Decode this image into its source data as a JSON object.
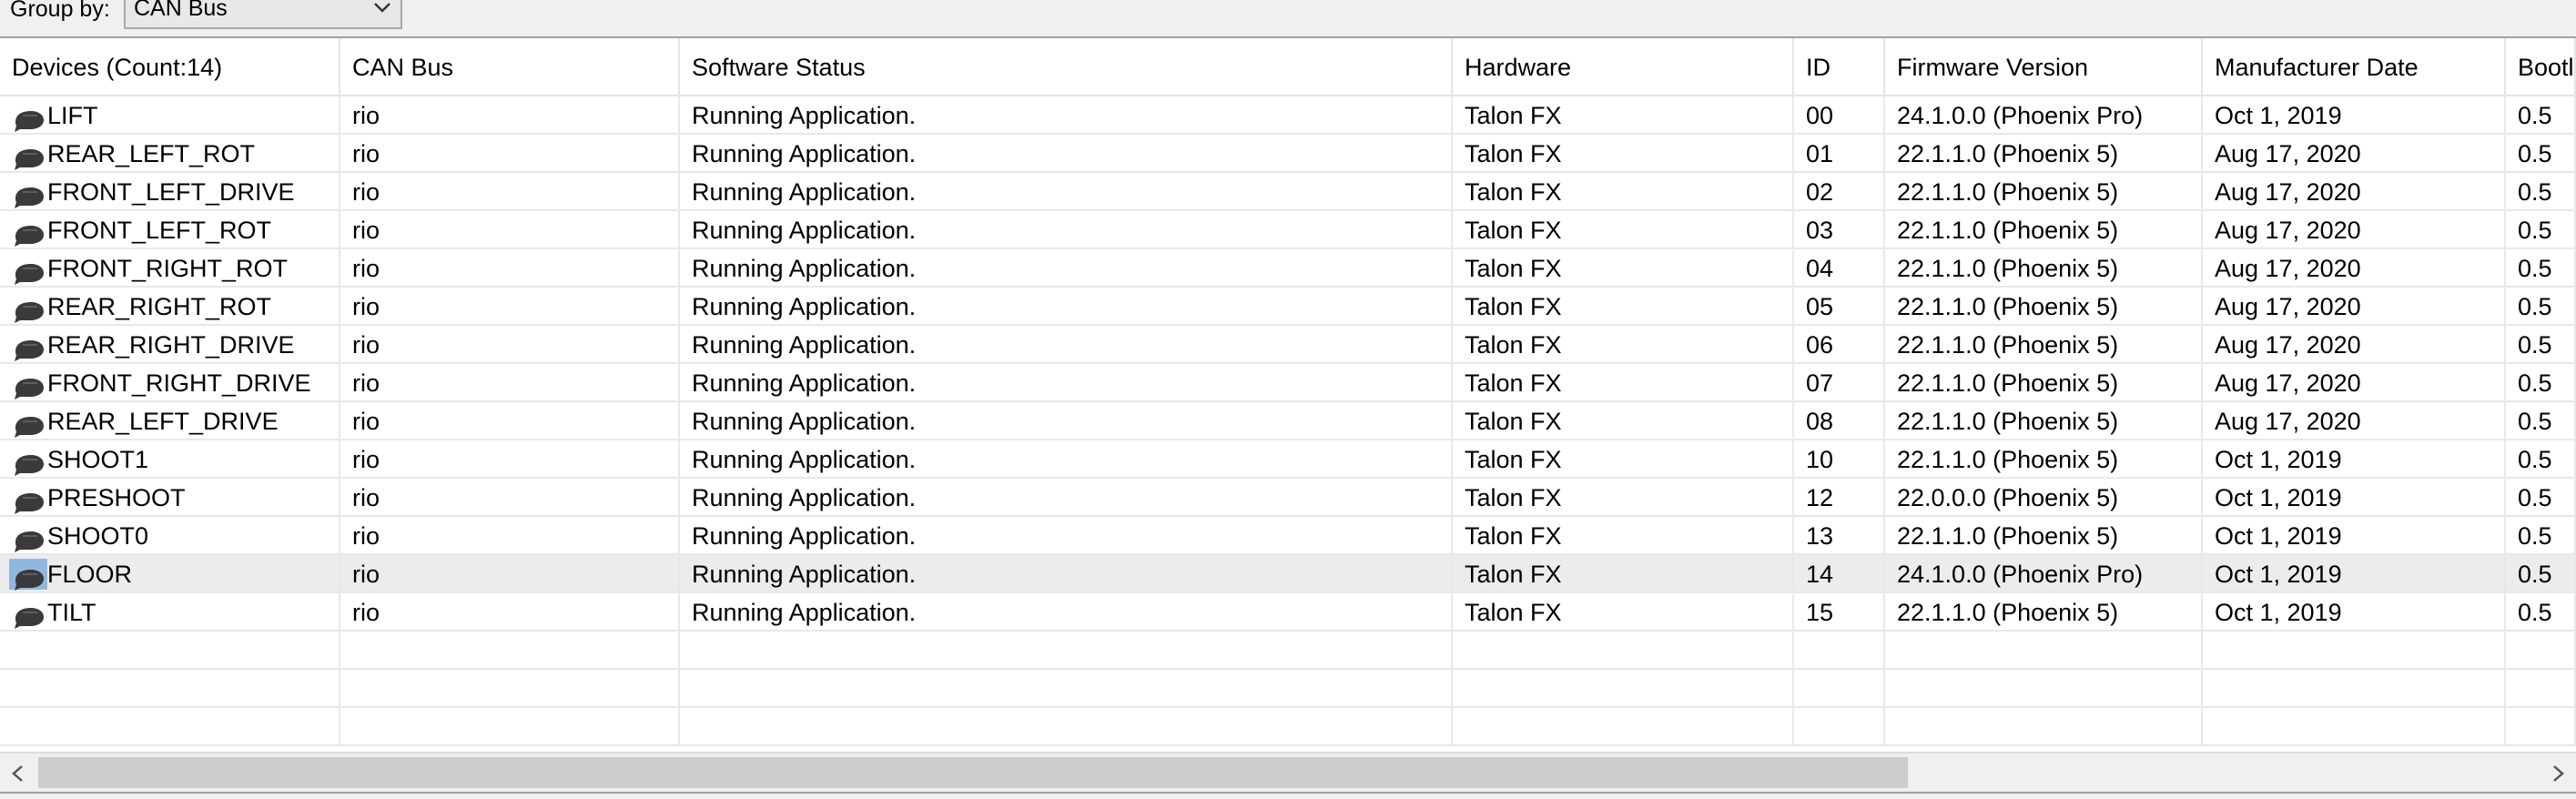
{
  "toolbar": {
    "group_by_label": "Group by:",
    "group_by_value": "CAN Bus"
  },
  "table": {
    "headers": [
      "Devices (Count:14)",
      "CAN Bus",
      "Software Status",
      "Hardware",
      "ID",
      "Firmware Version",
      "Manufacturer Date",
      "Bootl"
    ],
    "rows": [
      [
        "LIFT",
        "rio",
        "Running Application.",
        "Talon FX",
        "00",
        "24.1.0.0 (Phoenix Pro)",
        "Oct 1, 2019",
        "0.5"
      ],
      [
        "REAR_LEFT_ROT",
        "rio",
        "Running Application.",
        "Talon FX",
        "01",
        "22.1.1.0 (Phoenix 5)",
        "Aug 17, 2020",
        "0.5"
      ],
      [
        "FRONT_LEFT_DRIVE",
        "rio",
        "Running Application.",
        "Talon FX",
        "02",
        "22.1.1.0 (Phoenix 5)",
        "Aug 17, 2020",
        "0.5"
      ],
      [
        "FRONT_LEFT_ROT",
        "rio",
        "Running Application.",
        "Talon FX",
        "03",
        "22.1.1.0 (Phoenix 5)",
        "Aug 17, 2020",
        "0.5"
      ],
      [
        "FRONT_RIGHT_ROT",
        "rio",
        "Running Application.",
        "Talon FX",
        "04",
        "22.1.1.0 (Phoenix 5)",
        "Aug 17, 2020",
        "0.5"
      ],
      [
        "REAR_RIGHT_ROT",
        "rio",
        "Running Application.",
        "Talon FX",
        "05",
        "22.1.1.0 (Phoenix 5)",
        "Aug 17, 2020",
        "0.5"
      ],
      [
        "REAR_RIGHT_DRIVE",
        "rio",
        "Running Application.",
        "Talon FX",
        "06",
        "22.1.1.0 (Phoenix 5)",
        "Aug 17, 2020",
        "0.5"
      ],
      [
        "FRONT_RIGHT_DRIVE",
        "rio",
        "Running Application.",
        "Talon FX",
        "07",
        "22.1.1.0 (Phoenix 5)",
        "Aug 17, 2020",
        "0.5"
      ],
      [
        "REAR_LEFT_DRIVE",
        "rio",
        "Running Application.",
        "Talon FX",
        "08",
        "22.1.1.0 (Phoenix 5)",
        "Aug 17, 2020",
        "0.5"
      ],
      [
        "SHOOT1",
        "rio",
        "Running Application.",
        "Talon FX",
        "10",
        "22.1.1.0 (Phoenix 5)",
        "Oct 1, 2019",
        "0.5"
      ],
      [
        "PRESHOOT",
        "rio",
        "Running Application.",
        "Talon FX",
        "12",
        "22.0.0.0 (Phoenix 5)",
        "Oct 1, 2019",
        "0.5"
      ],
      [
        "SHOOT0",
        "rio",
        "Running Application.",
        "Talon FX",
        "13",
        "22.1.1.0 (Phoenix 5)",
        "Oct 1, 2019",
        "0.5"
      ],
      [
        "FLOOR",
        "rio",
        "Running Application.",
        "Talon FX",
        "14",
        "24.1.0.0 (Phoenix Pro)",
        "Oct 1, 2019",
        "0.5"
      ],
      [
        "TILT",
        "rio",
        "Running Application.",
        "Talon FX",
        "15",
        "22.1.1.0 (Phoenix 5)",
        "Oct 1, 2019",
        "0.5"
      ]
    ],
    "selected_row": 12,
    "device_icon": "talon-fx-motor-icon"
  },
  "colors": {
    "selection": "#8fb8e0",
    "selected_row_bg": "#ececec",
    "grid_line": "#e8e8e8"
  }
}
